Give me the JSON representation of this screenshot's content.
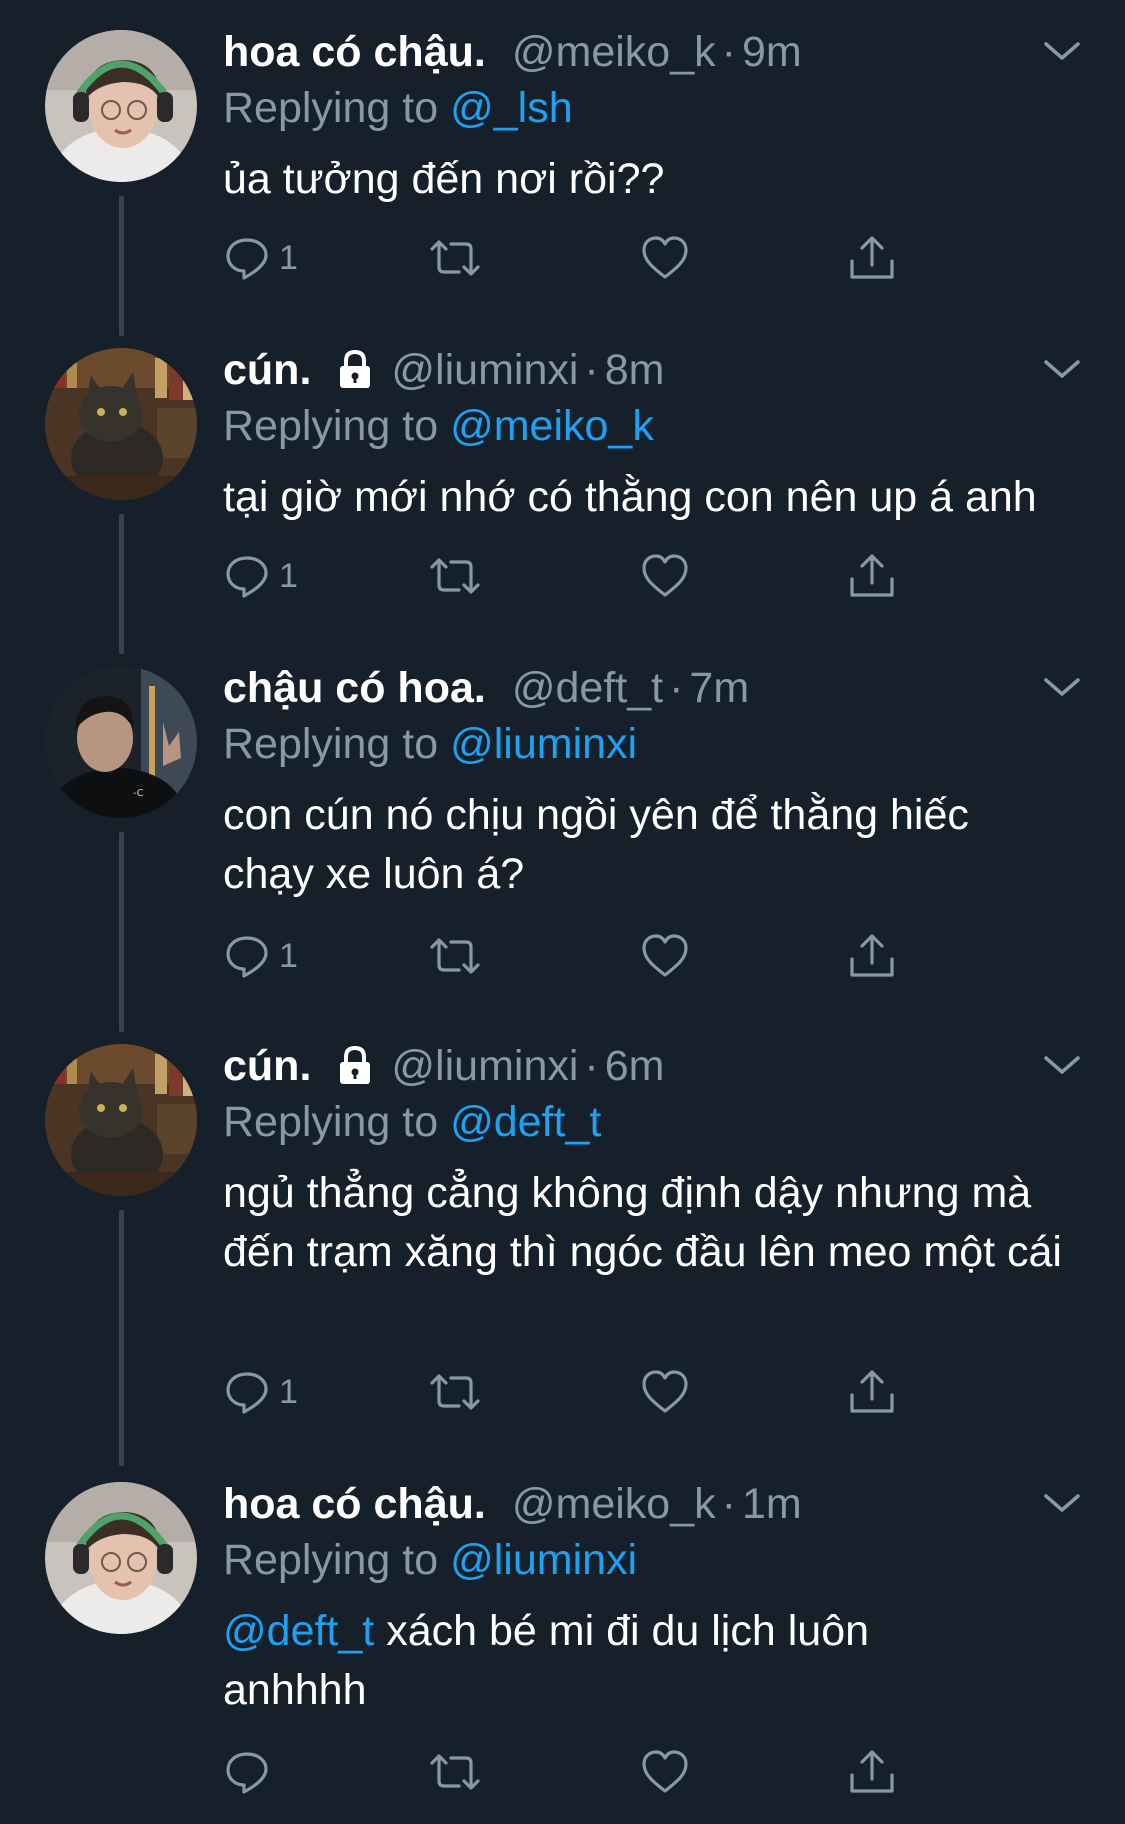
{
  "colors": {
    "background": "#15202b",
    "primary_text": "#ffffff",
    "secondary_text": "#8899a6",
    "link": "#1da1f2",
    "thread_line": "#38444d"
  },
  "icons": {
    "reply": "reply-icon",
    "retweet": "retweet-icon",
    "like": "heart-icon",
    "share": "share-icon",
    "more": "chevron-down-icon",
    "protected": "lock-icon"
  },
  "tweets": [
    {
      "name": "hoa có chậu.",
      "handle": "@meiko_k",
      "dot": "·",
      "time": "9m",
      "replying_prefix": "Replying to ",
      "replying_to": "@_lsh",
      "body": "ủa tưởng đến nơi rồi??",
      "reply_count": "1"
    },
    {
      "name": "cún.",
      "handle": "@liuminxi",
      "dot": "·",
      "time": "8m",
      "replying_prefix": "Replying to ",
      "replying_to": "@meiko_k",
      "body": "tại giờ mới nhớ có thằng con nên up á anh",
      "reply_count": "1"
    },
    {
      "name": "chậu có hoa.",
      "handle": "@deft_t",
      "dot": "·",
      "time": "7m",
      "replying_prefix": "Replying to ",
      "replying_to": "@liuminxi",
      "body": "con cún nó chịu ngồi yên để thằng hiếc chạy xe luôn á?",
      "reply_count": "1"
    },
    {
      "name": "cún.",
      "handle": "@liuminxi",
      "dot": "·",
      "time": "6m",
      "replying_prefix": "Replying to ",
      "replying_to": "@deft_t",
      "body": "ngủ thẳng cẳng không định dậy nhưng mà đến trạm xăng thì ngóc đầu lên meo một cái",
      "reply_count": "1"
    },
    {
      "name": "hoa có chậu.",
      "handle": "@meiko_k",
      "dot": "·",
      "time": "1m",
      "replying_prefix": "Replying to ",
      "replying_to": "@liuminxi",
      "body_mention": "@deft_t",
      "body": " xách bé mi đi du lịch luôn anhhhh",
      "reply_count": ""
    }
  ]
}
